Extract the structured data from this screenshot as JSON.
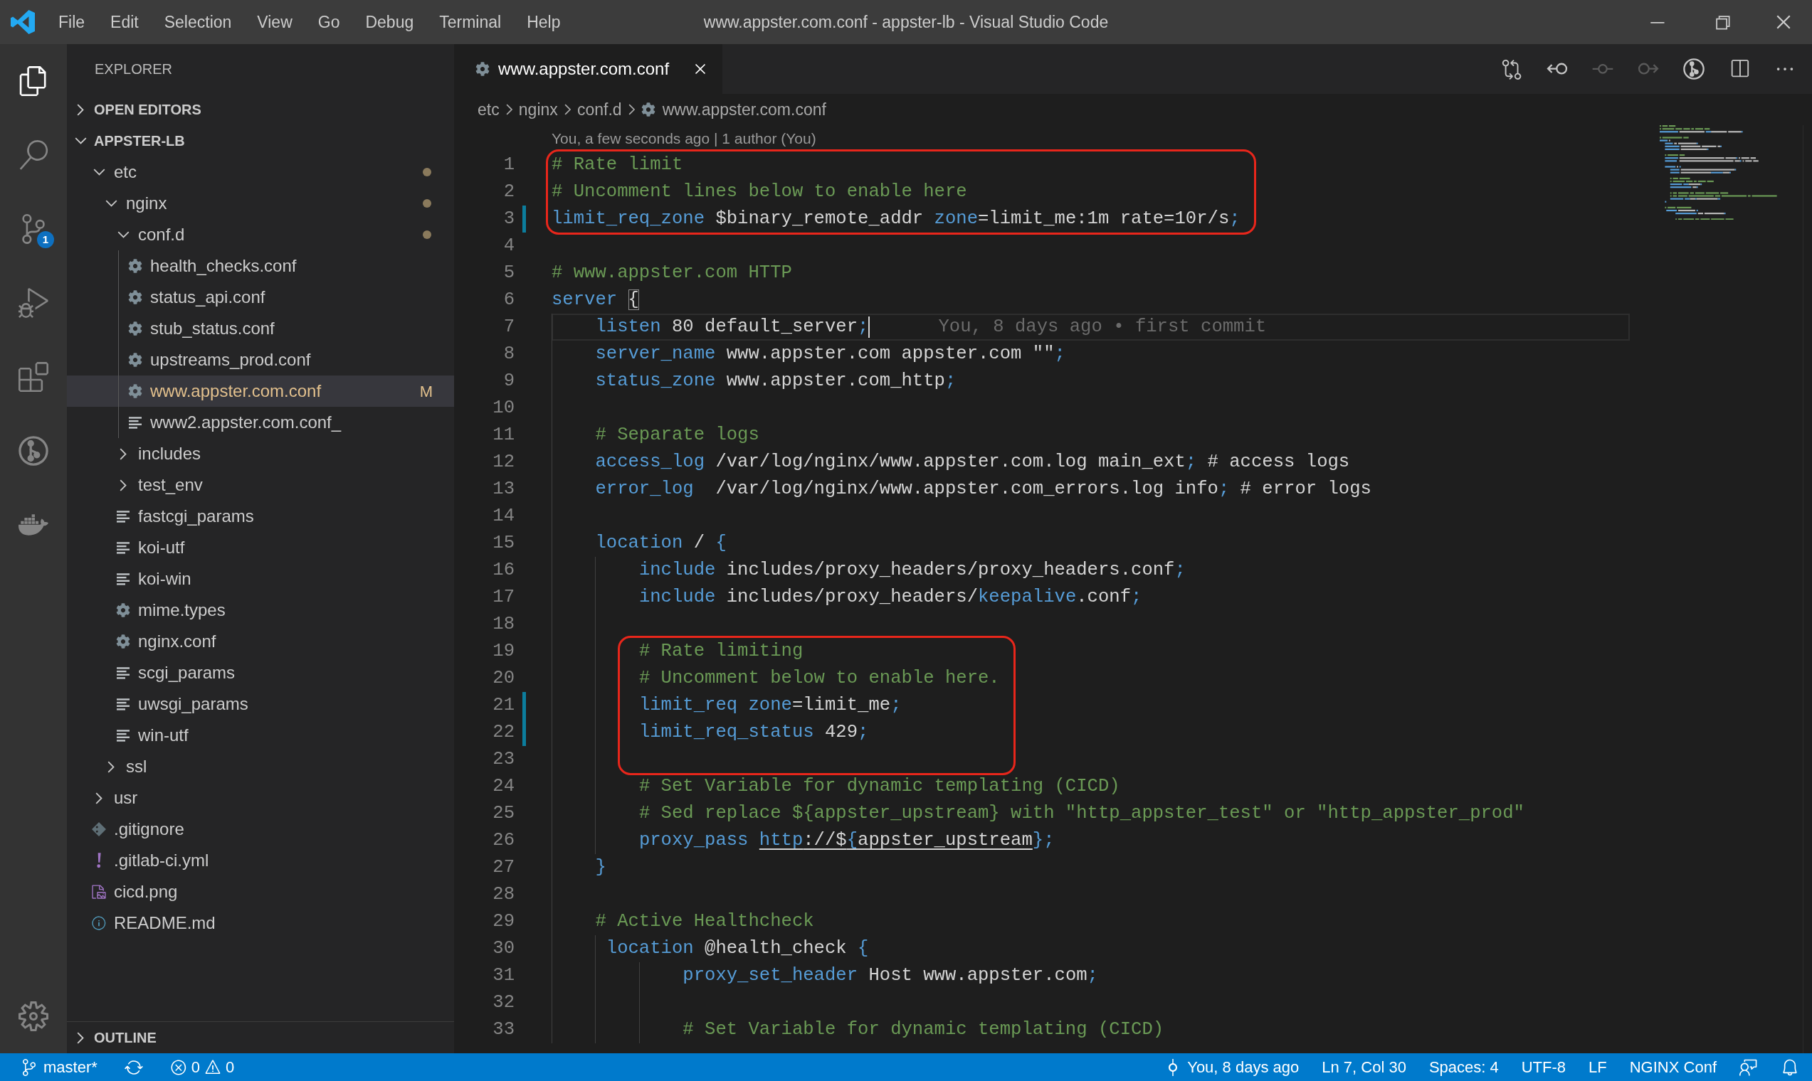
{
  "title_bar": {
    "menu": [
      "File",
      "Edit",
      "Selection",
      "View",
      "Go",
      "Debug",
      "Terminal",
      "Help"
    ],
    "title": "www.appster.com.conf - appster-lb - Visual Studio Code"
  },
  "activity_bar": {
    "items": [
      {
        "kind": "explorer",
        "selected": true
      },
      {
        "kind": "search",
        "selected": false
      },
      {
        "kind": "source-control",
        "selected": false,
        "badge": "1"
      },
      {
        "kind": "debug",
        "selected": false
      },
      {
        "kind": "extensions",
        "selected": false
      },
      {
        "kind": "git-history",
        "selected": false
      },
      {
        "kind": "docker",
        "selected": false
      }
    ],
    "bottom_items": [
      {
        "kind": "manage",
        "selected": false
      }
    ]
  },
  "explorer": {
    "title": "EXPLORER",
    "sections": [
      {
        "label": "OPEN EDITORS",
        "expanded": false
      },
      {
        "label": "APPSTER-LB",
        "expanded": true,
        "tree": [
          {
            "label": "etc",
            "kind": "folder",
            "expanded": true,
            "modified": true,
            "selected": false,
            "children": [
              {
                "label": "nginx",
                "kind": "folder",
                "expanded": true,
                "modified": true,
                "selected": false,
                "children": [
                  {
                    "label": "conf.d",
                    "kind": "folder",
                    "expanded": true,
                    "modified": true,
                    "selected": false,
                    "children": [
                      {
                        "label": "health_checks.conf",
                        "kind": "config",
                        "modified": false,
                        "selected": false
                      },
                      {
                        "label": "status_api.conf",
                        "kind": "config",
                        "modified": false,
                        "selected": false
                      },
                      {
                        "label": "stub_status.conf",
                        "kind": "config",
                        "modified": false,
                        "selected": false
                      },
                      {
                        "label": "upstreams_prod.conf",
                        "kind": "config",
                        "modified": false,
                        "selected": false
                      },
                      {
                        "label": "www.appster.com.conf",
                        "kind": "config",
                        "modified": true,
                        "selected": true,
                        "badge": "M"
                      },
                      {
                        "label": "www2.appster.com.conf_",
                        "kind": "text",
                        "modified": false,
                        "selected": false
                      }
                    ]
                  },
                  {
                    "label": "includes",
                    "kind": "folder",
                    "expanded": false,
                    "modified": false,
                    "selected": false
                  },
                  {
                    "label": "test_env",
                    "kind": "folder",
                    "expanded": false,
                    "modified": false,
                    "selected": false
                  },
                  {
                    "label": "fastcgi_params",
                    "kind": "text",
                    "modified": false,
                    "selected": false
                  },
                  {
                    "label": "koi-utf",
                    "kind": "text",
                    "modified": false,
                    "selected": false
                  },
                  {
                    "label": "koi-win",
                    "kind": "text",
                    "modified": false,
                    "selected": false
                  },
                  {
                    "label": "mime.types",
                    "kind": "config",
                    "modified": false,
                    "selected": false
                  },
                  {
                    "label": "nginx.conf",
                    "kind": "config",
                    "modified": false,
                    "selected": false
                  },
                  {
                    "label": "scgi_params",
                    "kind": "text",
                    "modified": false,
                    "selected": false
                  },
                  {
                    "label": "uwsgi_params",
                    "kind": "text",
                    "modified": false,
                    "selected": false
                  },
                  {
                    "label": "win-utf",
                    "kind": "text",
                    "modified": false,
                    "selected": false
                  }
                ]
              },
              {
                "label": "ssl",
                "kind": "folder",
                "expanded": false,
                "modified": false,
                "selected": false
              }
            ]
          },
          {
            "label": "usr",
            "kind": "folder",
            "expanded": false,
            "modified": false,
            "selected": false
          },
          {
            "label": ".gitignore",
            "kind": "gitignore",
            "modified": false,
            "selected": false
          },
          {
            "label": ".gitlab-ci.yml",
            "kind": "yaml",
            "modified": false,
            "selected": false
          },
          {
            "label": "cicd.png",
            "kind": "image",
            "modified": false,
            "selected": false
          },
          {
            "label": "README.md",
            "kind": "readme",
            "modified": false,
            "selected": false
          }
        ]
      },
      {
        "label": "OUTLINE",
        "expanded": false
      }
    ]
  },
  "editor": {
    "tabs": [
      {
        "label": "www.appster.com.conf",
        "kind": "config",
        "selected": true
      }
    ],
    "actions": [
      {
        "kind": "compare",
        "disabled": false
      },
      {
        "kind": "previous",
        "disabled": false
      },
      {
        "kind": "commit",
        "disabled": true
      },
      {
        "kind": "next",
        "disabled": true
      },
      {
        "kind": "history",
        "disabled": false
      },
      {
        "kind": "split",
        "disabled": false
      },
      {
        "kind": "more",
        "disabled": false
      }
    ],
    "breadcrumb": [
      {
        "label": "etc",
        "kind": "folder"
      },
      {
        "label": "nginx",
        "kind": "folder"
      },
      {
        "label": "conf.d",
        "kind": "folder"
      },
      {
        "label": "www.appster.com.conf",
        "kind": "config"
      }
    ],
    "codelens": "You, a few seconds ago | 1 author (You)",
    "lines": [
      {
        "number": "1",
        "tokens": [
          {
            "text": "# Rate limit",
            "kind": "comment"
          }
        ],
        "modified": false,
        "annotated": true,
        "current": false
      },
      {
        "number": "2",
        "tokens": [
          {
            "text": "# Uncomment lines below to enable here",
            "kind": "comment"
          }
        ],
        "modified": false,
        "annotated": true,
        "current": false
      },
      {
        "number": "3",
        "tokens": [
          {
            "text": "limit_req_zone",
            "kind": "directive"
          },
          {
            "text": " $binary_remote_addr ",
            "kind": "text"
          },
          {
            "text": "zone",
            "kind": "directive"
          },
          {
            "text": "=limit_me:1m rate=10r/s",
            "kind": "text"
          },
          {
            "text": ";",
            "kind": "punct"
          }
        ],
        "modified": true,
        "annotated": true,
        "current": false
      },
      {
        "number": "4",
        "modified": false,
        "annotated": false,
        "current": false
      },
      {
        "number": "5",
        "tokens": [
          {
            "text": "# www.appster.com HTTP",
            "kind": "comment"
          }
        ],
        "modified": false,
        "annotated": false,
        "current": false
      },
      {
        "number": "6",
        "tokens": [
          {
            "text": "server ",
            "kind": "directive"
          },
          {
            "text": "{",
            "kind": "bracket_match"
          }
        ],
        "modified": false,
        "annotated": false,
        "current": false
      },
      {
        "number": "7",
        "tokens": [
          {
            "text": "    listen",
            "kind": "directive"
          },
          {
            "text": " 80 default_server",
            "kind": "text"
          },
          {
            "text": ";",
            "kind": "punct"
          }
        ],
        "modified": false,
        "annotated": false,
        "current": true,
        "blame": "You, 8 days ago • first commit"
      },
      {
        "number": "8",
        "tokens": [
          {
            "text": "    server_name",
            "kind": "directive"
          },
          {
            "text": " www.appster.com appster.com \"\"",
            "kind": "text"
          },
          {
            "text": ";",
            "kind": "punct"
          }
        ],
        "modified": false,
        "annotated": false,
        "current": false
      },
      {
        "number": "9",
        "tokens": [
          {
            "text": "    status_zone",
            "kind": "directive"
          },
          {
            "text": " www.appster.com_http",
            "kind": "text"
          },
          {
            "text": ";",
            "kind": "punct"
          }
        ],
        "modified": false,
        "annotated": false,
        "current": false
      },
      {
        "number": "10",
        "modified": false,
        "annotated": false,
        "current": false
      },
      {
        "number": "11",
        "tokens": [
          {
            "text": "    # Separate logs",
            "kind": "comment"
          }
        ],
        "modified": false,
        "annotated": false,
        "current": false
      },
      {
        "number": "12",
        "tokens": [
          {
            "text": "    access_log",
            "kind": "directive"
          },
          {
            "text": " /var/log/nginx/www.appster.com.log main_ext",
            "kind": "text"
          },
          {
            "text": ";",
            "kind": "punct"
          },
          {
            "text": " # access logs",
            "kind": "text"
          }
        ],
        "modified": false,
        "annotated": false,
        "current": false
      },
      {
        "number": "13",
        "tokens": [
          {
            "text": "    error_log",
            "kind": "directive"
          },
          {
            "text": "  /var/log/nginx/www.appster.com_errors.log info",
            "kind": "text"
          },
          {
            "text": ";",
            "kind": "punct"
          },
          {
            "text": " # error logs",
            "kind": "text"
          }
        ],
        "modified": false,
        "annotated": false,
        "current": false
      },
      {
        "number": "14",
        "modified": false,
        "annotated": false,
        "current": false
      },
      {
        "number": "15",
        "tokens": [
          {
            "text": "    location",
            "kind": "directive"
          },
          {
            "text": " / ",
            "kind": "text"
          },
          {
            "text": "{",
            "kind": "punct"
          }
        ],
        "modified": false,
        "annotated": false,
        "current": false
      },
      {
        "number": "16",
        "tokens": [
          {
            "text": "        include",
            "kind": "directive"
          },
          {
            "text": " includes/proxy_headers/proxy_headers.conf",
            "kind": "text"
          },
          {
            "text": ";",
            "kind": "punct"
          }
        ],
        "modified": false,
        "annotated": false,
        "current": false
      },
      {
        "number": "17",
        "tokens": [
          {
            "text": "        include",
            "kind": "directive"
          },
          {
            "text": " includes/proxy_headers/",
            "kind": "text"
          },
          {
            "text": "keepalive",
            "kind": "directive"
          },
          {
            "text": ".conf",
            "kind": "text"
          },
          {
            "text": ";",
            "kind": "punct"
          }
        ],
        "modified": false,
        "annotated": false,
        "current": false
      },
      {
        "number": "18",
        "modified": false,
        "annotated": false,
        "current": false
      },
      {
        "number": "19",
        "tokens": [
          {
            "text": "        # Rate limiting",
            "kind": "comment"
          }
        ],
        "modified": false,
        "annotated": true,
        "current": false
      },
      {
        "number": "20",
        "tokens": [
          {
            "text": "        # Uncomment below to enable here.",
            "kind": "comment"
          }
        ],
        "modified": false,
        "annotated": true,
        "current": false
      },
      {
        "number": "21",
        "tokens": [
          {
            "text": "        limit_req ",
            "kind": "directive"
          },
          {
            "text": "zone",
            "kind": "directive"
          },
          {
            "text": "=limit_me",
            "kind": "text"
          },
          {
            "text": ";",
            "kind": "punct"
          }
        ],
        "modified": true,
        "annotated": true,
        "current": false
      },
      {
        "number": "22",
        "tokens": [
          {
            "text": "        limit_req_status",
            "kind": "directive"
          },
          {
            "text": " 429",
            "kind": "text"
          },
          {
            "text": ";",
            "kind": "punct"
          }
        ],
        "modified": true,
        "annotated": true,
        "current": false
      },
      {
        "number": "23",
        "modified": false,
        "annotated": true,
        "current": false
      },
      {
        "number": "24",
        "tokens": [
          {
            "text": "        # Set Variable for dynamic templating (CICD)",
            "kind": "comment"
          }
        ],
        "modified": false,
        "annotated": false,
        "current": false
      },
      {
        "number": "25",
        "tokens": [
          {
            "text": "        # Sed replace ${appster_upstream} with \"http_appster_test\" or \"http_appster_prod\"",
            "kind": "comment"
          }
        ],
        "modified": false,
        "annotated": false,
        "current": false
      },
      {
        "number": "26",
        "tokens": [
          {
            "text": "        proxy_pass ",
            "kind": "directive"
          },
          {
            "text": "http",
            "kind": "link_directive"
          },
          {
            "text": "://$",
            "kind": "link"
          },
          {
            "text": "{",
            "kind": "link_directive"
          },
          {
            "text": "appster_upstream",
            "kind": "link"
          },
          {
            "text": "}",
            "kind": "punct"
          },
          {
            "text": ";",
            "kind": "punct"
          }
        ],
        "modified": false,
        "annotated": false,
        "current": false
      },
      {
        "number": "27",
        "tokens": [
          {
            "text": "    }",
            "kind": "punct"
          }
        ],
        "modified": false,
        "annotated": false,
        "current": false
      },
      {
        "number": "28",
        "modified": false,
        "annotated": false,
        "current": false
      },
      {
        "number": "29",
        "tokens": [
          {
            "text": "    # Active Healthcheck",
            "kind": "comment"
          }
        ],
        "modified": false,
        "annotated": false,
        "current": false
      },
      {
        "number": "30",
        "tokens": [
          {
            "text": "     location",
            "kind": "directive"
          },
          {
            "text": " @health_check ",
            "kind": "text"
          },
          {
            "text": "{",
            "kind": "punct"
          }
        ],
        "modified": false,
        "annotated": false,
        "current": false
      },
      {
        "number": "31",
        "tokens": [
          {
            "text": "            proxy_set_header",
            "kind": "directive"
          },
          {
            "text": " Host www.appster.com",
            "kind": "text"
          },
          {
            "text": ";",
            "kind": "punct"
          }
        ],
        "modified": false,
        "annotated": false,
        "current": false
      },
      {
        "number": "32",
        "modified": false,
        "annotated": false,
        "current": false
      },
      {
        "number": "33",
        "tokens": [
          {
            "text": "            # Set Variable for dynamic templating (CICD)",
            "kind": "comment"
          }
        ],
        "modified": false,
        "annotated": false,
        "current": false
      }
    ]
  },
  "status_bar": {
    "left": [
      {
        "kind": "branch",
        "label": "master*"
      },
      {
        "kind": "sync"
      },
      {
        "kind": "problems",
        "errors": "0",
        "warnings": "0"
      }
    ],
    "right": [
      {
        "kind": "blame",
        "label": "You, 8 days ago"
      },
      {
        "kind": "text",
        "label": "Ln 7, Col 30"
      },
      {
        "kind": "text",
        "label": "Spaces: 4"
      },
      {
        "kind": "text",
        "label": "UTF-8"
      },
      {
        "kind": "text",
        "label": "LF"
      },
      {
        "kind": "text",
        "label": "NGINX Conf"
      },
      {
        "kind": "feedback"
      },
      {
        "kind": "notifications"
      }
    ]
  }
}
